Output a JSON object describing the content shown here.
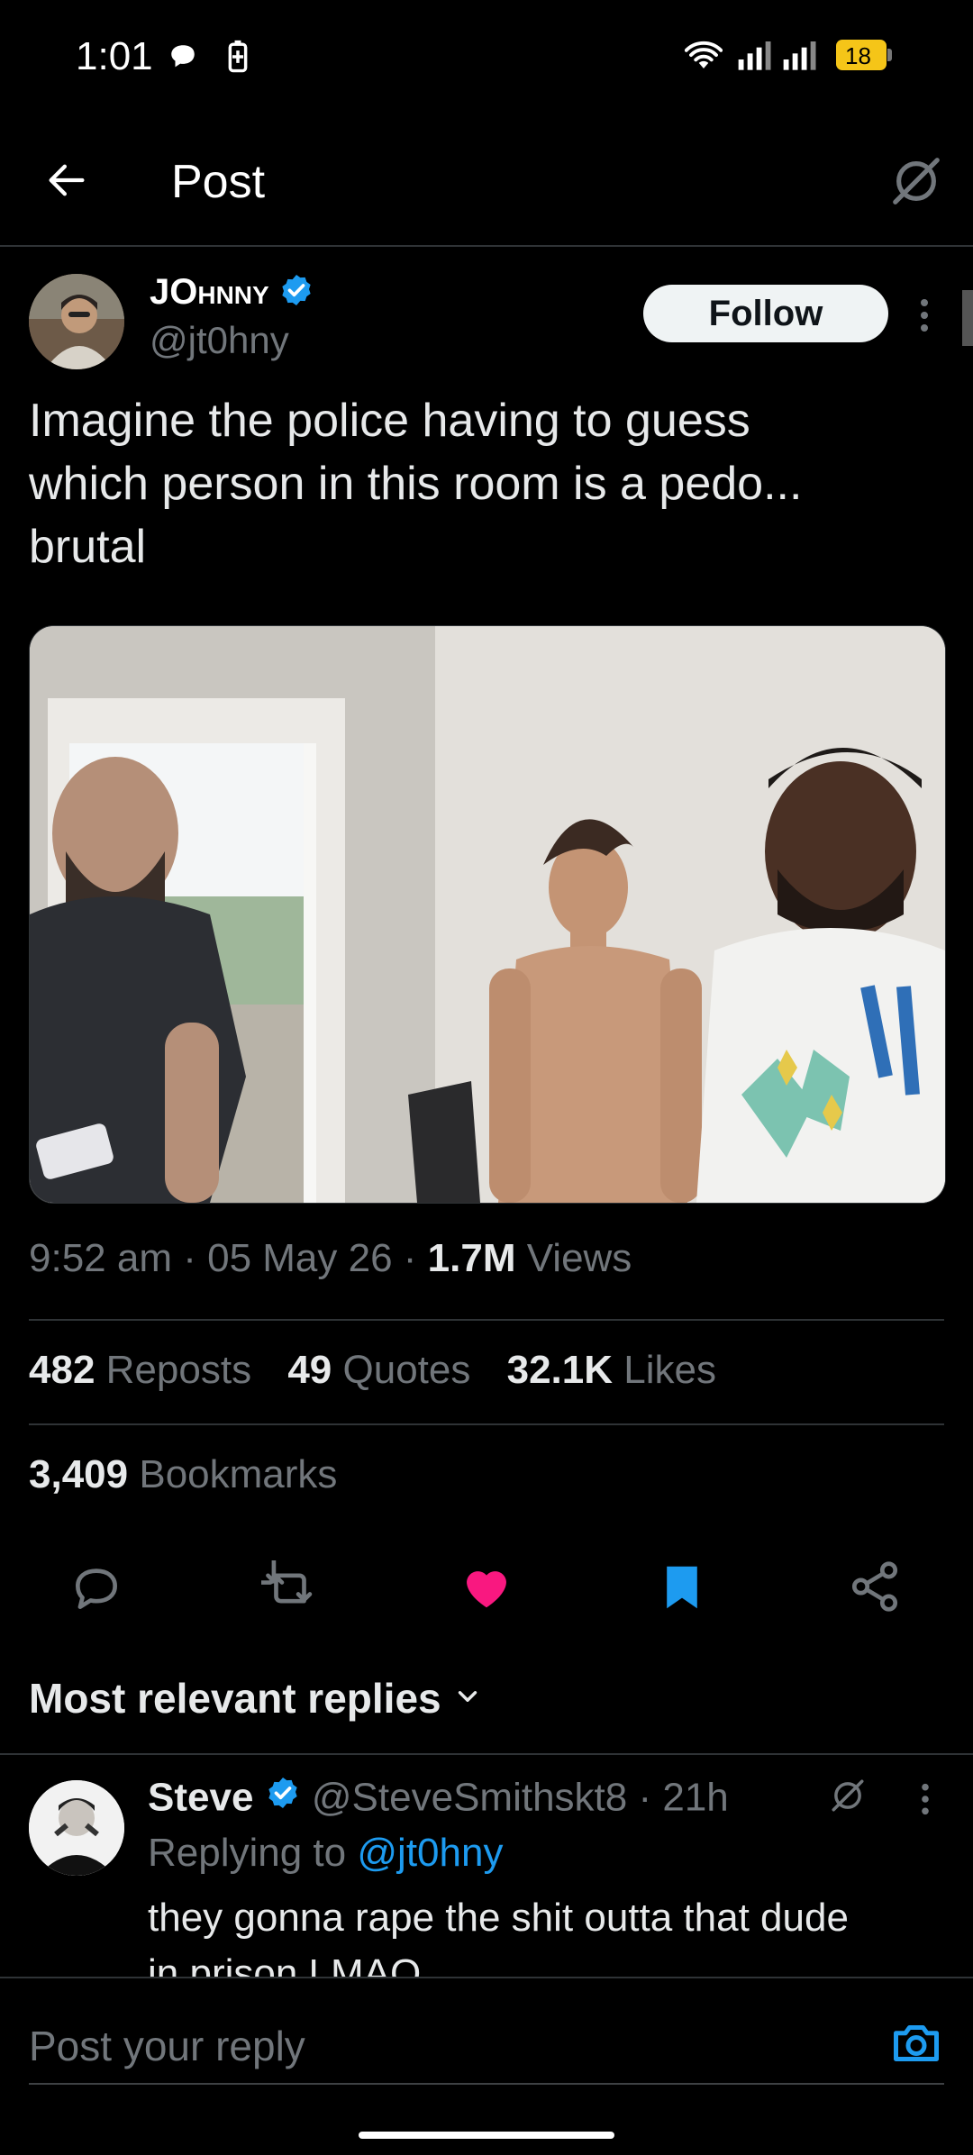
{
  "status_bar": {
    "time": "1:01",
    "battery": "18"
  },
  "header": {
    "title": "Post"
  },
  "post": {
    "display_name": "JOhnny",
    "handle": "@jt0hny",
    "follow_label": "Follow",
    "text_line1": "Imagine the police having to guess",
    "text_line2": "which person in this room is a pedo...",
    "text_line3": "brutal",
    "time": "9:52 am",
    "date": "05 May 26",
    "views_count": "1.7M",
    "views_label": "Views",
    "reposts_count": "482",
    "reposts_label": "Reposts",
    "quotes_count": "49",
    "quotes_label": "Quotes",
    "likes_count": "32.1K",
    "likes_label": "Likes",
    "bookmarks_count": "3,409",
    "bookmarks_label": "Bookmarks"
  },
  "replies_sort": {
    "label": "Most relevant replies"
  },
  "reply": {
    "name": "Steve",
    "handle": "@SteveSmithskt8",
    "age": "21h",
    "replying_prefix": "Replying to",
    "replying_to": "@jt0hny",
    "text_line1": "they gonna rape the shit outta that dude",
    "text_line2": "in prison LMAO"
  },
  "composer": {
    "placeholder": "Post your reply"
  },
  "colors": {
    "accent": "#1d9bf0",
    "like": "#f91880",
    "background": "#000000",
    "muted": "#71767b"
  }
}
